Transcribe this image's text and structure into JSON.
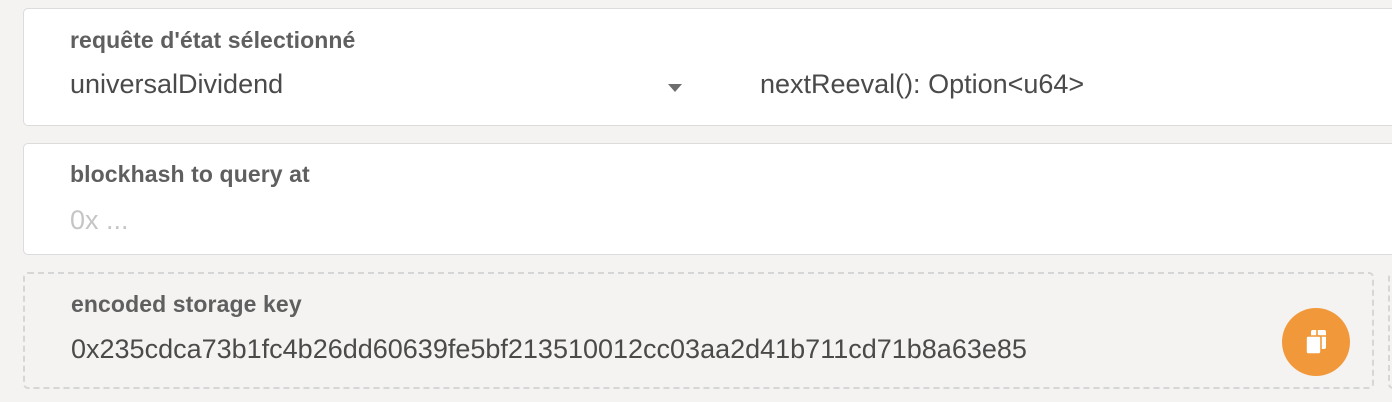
{
  "state_query": {
    "label": "requête d'état sélectionné",
    "module_value": "universalDividend",
    "method_value": "nextReeval(): Option<u64>"
  },
  "blockhash": {
    "label": "blockhash to query at",
    "placeholder": "0x ...",
    "value": ""
  },
  "encoded_key": {
    "label": "encoded storage key",
    "value": "0x235cdca73b1fc4b26dd60639fe5bf213510012cc03aa2d41b711cd71b8a63e85",
    "copy_icon": "copy-icon"
  },
  "colors": {
    "accent": "#f1993a",
    "background": "#f4f3f1",
    "text": "#4a4a4a",
    "label": "#5f5f5f",
    "placeholder": "#c5c5c5"
  }
}
